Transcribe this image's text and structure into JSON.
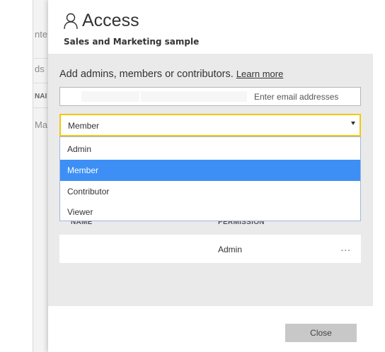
{
  "background": {
    "fragments": [
      "nte",
      "ds",
      "NAI",
      "Ma"
    ]
  },
  "panel": {
    "title": "Access",
    "subtitle": "Sales and Marketing sample",
    "icon": "person-icon"
  },
  "access_form": {
    "add_label": "Add admins, members or contributors.",
    "learn_more": "Learn more",
    "email_placeholder": "Enter email addresses",
    "selected_role": "Member",
    "role_options": [
      {
        "label": "Admin",
        "selected": false
      },
      {
        "label": "Member",
        "selected": true
      },
      {
        "label": "Contributor",
        "selected": false
      },
      {
        "label": "Viewer",
        "selected": false
      }
    ]
  },
  "table": {
    "columns": [
      "NAME",
      "PERMISSION"
    ],
    "rows": [
      {
        "name": "",
        "permission": "Admin",
        "more": "..."
      }
    ]
  },
  "footer": {
    "close_label": "Close"
  },
  "colors": {
    "focus_border": "#f2c811",
    "selected_option": "#3d8ff5",
    "body_bg": "#eaeaea"
  }
}
